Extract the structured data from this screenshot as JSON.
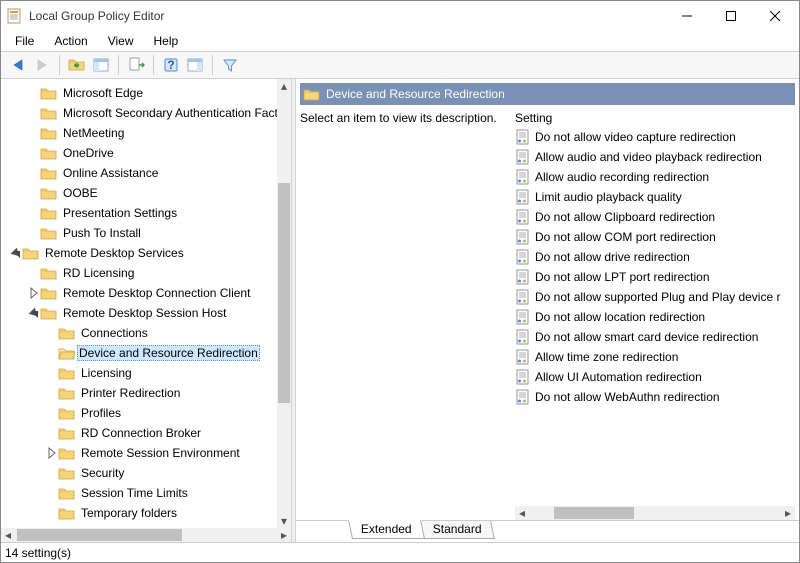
{
  "window": {
    "title": "Local Group Policy Editor"
  },
  "menu": {
    "items": [
      "File",
      "Action",
      "View",
      "Help"
    ]
  },
  "toolbar": {
    "back": "Back",
    "forward": "Forward",
    "up": "Up one level",
    "props": "Show/Hide Console Tree",
    "export": "Export List",
    "help": "Help",
    "tree": "Show/Hide Action Pane",
    "filter": "Filter"
  },
  "tree": {
    "items": [
      {
        "indent": 1,
        "exp": "",
        "label": "Microsoft Edge"
      },
      {
        "indent": 1,
        "exp": "",
        "label": "Microsoft Secondary Authentication Fact"
      },
      {
        "indent": 1,
        "exp": "",
        "label": "NetMeeting"
      },
      {
        "indent": 1,
        "exp": "",
        "label": "OneDrive"
      },
      {
        "indent": 1,
        "exp": "",
        "label": "Online Assistance"
      },
      {
        "indent": 1,
        "exp": "",
        "label": "OOBE"
      },
      {
        "indent": 1,
        "exp": "",
        "label": "Presentation Settings"
      },
      {
        "indent": 1,
        "exp": "",
        "label": "Push To Install"
      },
      {
        "indent": 0,
        "exp": "open",
        "label": "Remote Desktop Services"
      },
      {
        "indent": 1,
        "exp": "",
        "label": "RD Licensing"
      },
      {
        "indent": 1,
        "exp": "closed",
        "label": "Remote Desktop Connection Client"
      },
      {
        "indent": 1,
        "exp": "open",
        "label": "Remote Desktop Session Host"
      },
      {
        "indent": 2,
        "exp": "",
        "label": "Connections"
      },
      {
        "indent": 2,
        "exp": "",
        "label": "Device and Resource Redirection",
        "selected": true
      },
      {
        "indent": 2,
        "exp": "",
        "label": "Licensing"
      },
      {
        "indent": 2,
        "exp": "",
        "label": "Printer Redirection"
      },
      {
        "indent": 2,
        "exp": "",
        "label": "Profiles"
      },
      {
        "indent": 2,
        "exp": "",
        "label": "RD Connection Broker"
      },
      {
        "indent": 2,
        "exp": "closed",
        "label": "Remote Session Environment"
      },
      {
        "indent": 2,
        "exp": "",
        "label": "Security"
      },
      {
        "indent": 2,
        "exp": "",
        "label": "Session Time Limits"
      },
      {
        "indent": 2,
        "exp": "",
        "label": "Temporary folders"
      }
    ]
  },
  "details": {
    "category_title": "Device and Resource Redirection",
    "description_prompt": "Select an item to view its description.",
    "setting_header": "Setting",
    "settings": [
      "Do not allow video capture redirection",
      "Allow audio and video playback redirection",
      "Allow audio recording redirection",
      "Limit audio playback quality",
      "Do not allow Clipboard redirection",
      "Do not allow COM port redirection",
      "Do not allow drive redirection",
      "Do not allow LPT port redirection",
      "Do not allow supported Plug and Play device r",
      "Do not allow location redirection",
      "Do not allow smart card device redirection",
      "Allow time zone redirection",
      "Allow UI Automation redirection",
      "Do not allow WebAuthn redirection"
    ]
  },
  "tabs": {
    "extended": "Extended",
    "standard": "Standard",
    "active": "extended"
  },
  "status": {
    "text": "14 setting(s)"
  }
}
